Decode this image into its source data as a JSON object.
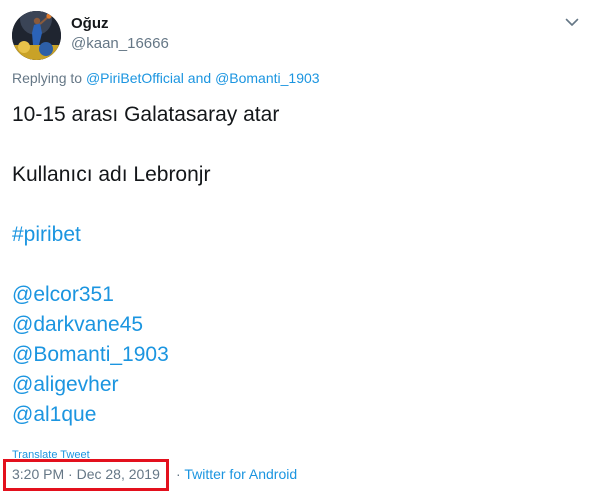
{
  "tweet": {
    "display_name": "Oğuz",
    "handle": "@kaan_16666",
    "reply": {
      "prefix": "Replying to ",
      "user1": "@PiriBetOfficial",
      "conjunction": " and ",
      "user2": "@Bomanti_1903"
    },
    "lines": {
      "line1": "10-15 arası Galatasaray atar",
      "line2": "Kullanıcı adı Lebronjr",
      "hashtag": "#piribet",
      "mention1": "@elcor351",
      "mention2": "@darkvane45",
      "mention3": "@Bomanti_1903",
      "mention4": "@aligevher",
      "mention5": "@al1que"
    },
    "translate_label": "Translate Tweet",
    "timestamp": "3:20 PM · Dec 28, 2019",
    "separator": " · ",
    "source": "Twitter for Android",
    "menu_icon": "chevron-down-icon"
  },
  "colors": {
    "link": "#1b95e0",
    "secondary": "#657786",
    "text": "#14171a",
    "highlight": "#e3101d"
  }
}
